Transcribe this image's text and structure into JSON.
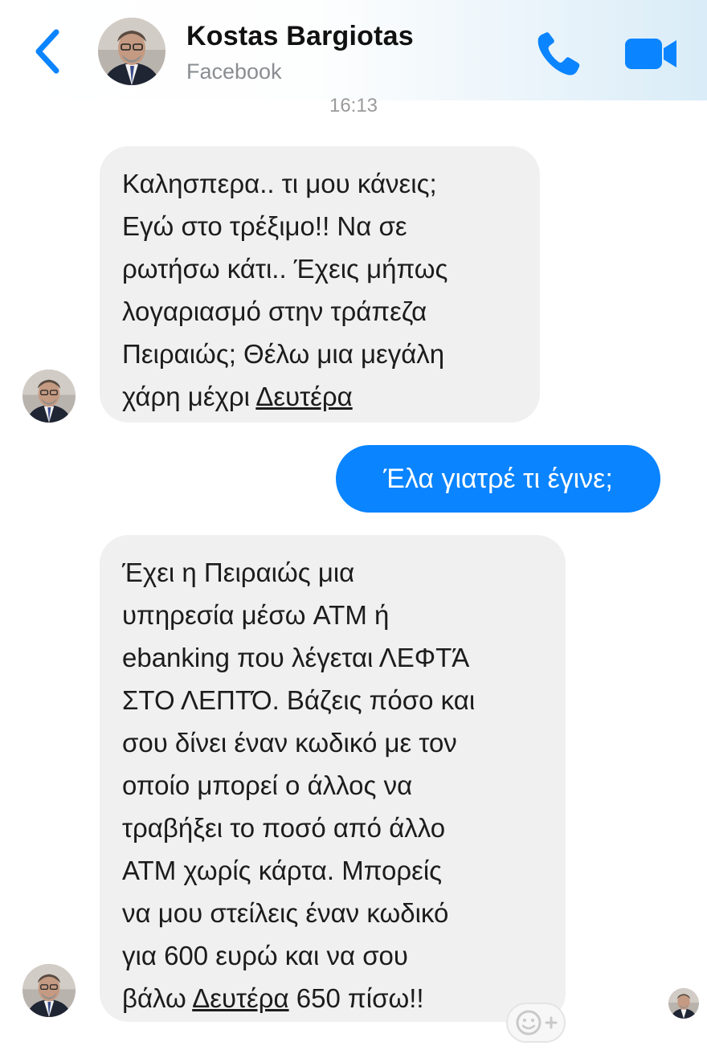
{
  "header": {
    "contact_name": "Kostas Bargiotas",
    "source": "Facebook",
    "back_icon": "chevron-left-icon",
    "call_icon": "phone-icon",
    "video_icon": "video-camera-icon",
    "accent_color": "#0a84ff"
  },
  "timestamp": "16:13",
  "messages": [
    {
      "direction": "incoming",
      "text_before": "Καλησπερα.. τι μου κάνεις;\nΕγώ στο τρέξιμο!! Να σε\nρωτήσω κάτι.. Έχεις μήπως\nλογαριασμό στην τράπεζα\nΠειραιώς; Θέλω μια μεγάλη\nχάρη μέχρι ",
      "link_text": "Δευτέρα",
      "text_after": ""
    },
    {
      "direction": "outgoing",
      "text": "Έλα γιατρέ τι έγινε;"
    },
    {
      "direction": "incoming",
      "text_before": "Έχει η Πειραιώς μια\nυπηρεσία μέσω ATM ή\nebanking που λέγεται ΛΕΦΤΆ\nΣΤΟ ΛΕΠΤΌ. Βάζεις πόσο και\nσου δίνει έναν κωδικό με τον\nοποίο μπορεί ο άλλος να\nτραβήξει το ποσό από άλλο\nATM χωρίς κάρτα. Μπορείς\nνα μου στείλεις έναν κωδικό\nγια 600 ευρώ και να σου\nβάλω ",
      "link_text": "Δευτέρα",
      "text_after": " 650 πίσω!!"
    }
  ],
  "icons": {
    "reaction": "smiley-plus-icon",
    "avatar": "avatar-photo"
  },
  "colors": {
    "incoming_bubble": "#f0f0f0",
    "outgoing_bubble": "#0a84ff"
  }
}
